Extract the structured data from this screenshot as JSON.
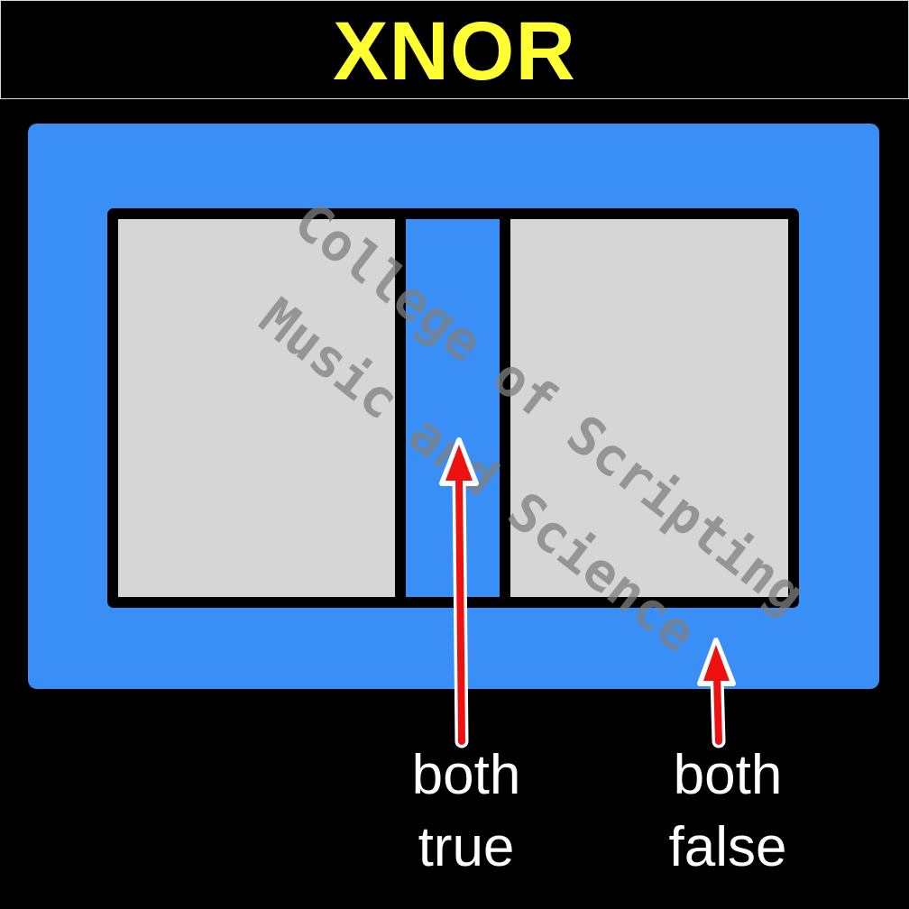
{
  "title": "XNOR",
  "watermark": {
    "line1": "College of Scripting",
    "line2": "Music and Science"
  },
  "labels": {
    "both_true": [
      "both",
      "true"
    ],
    "both_false": [
      "both",
      "false"
    ]
  },
  "colors": {
    "title": "#ffff33",
    "highlight": "#3a8ff6",
    "set_fill": "#d6d6d6",
    "arrow": "#ee1111",
    "background": "#000000"
  }
}
